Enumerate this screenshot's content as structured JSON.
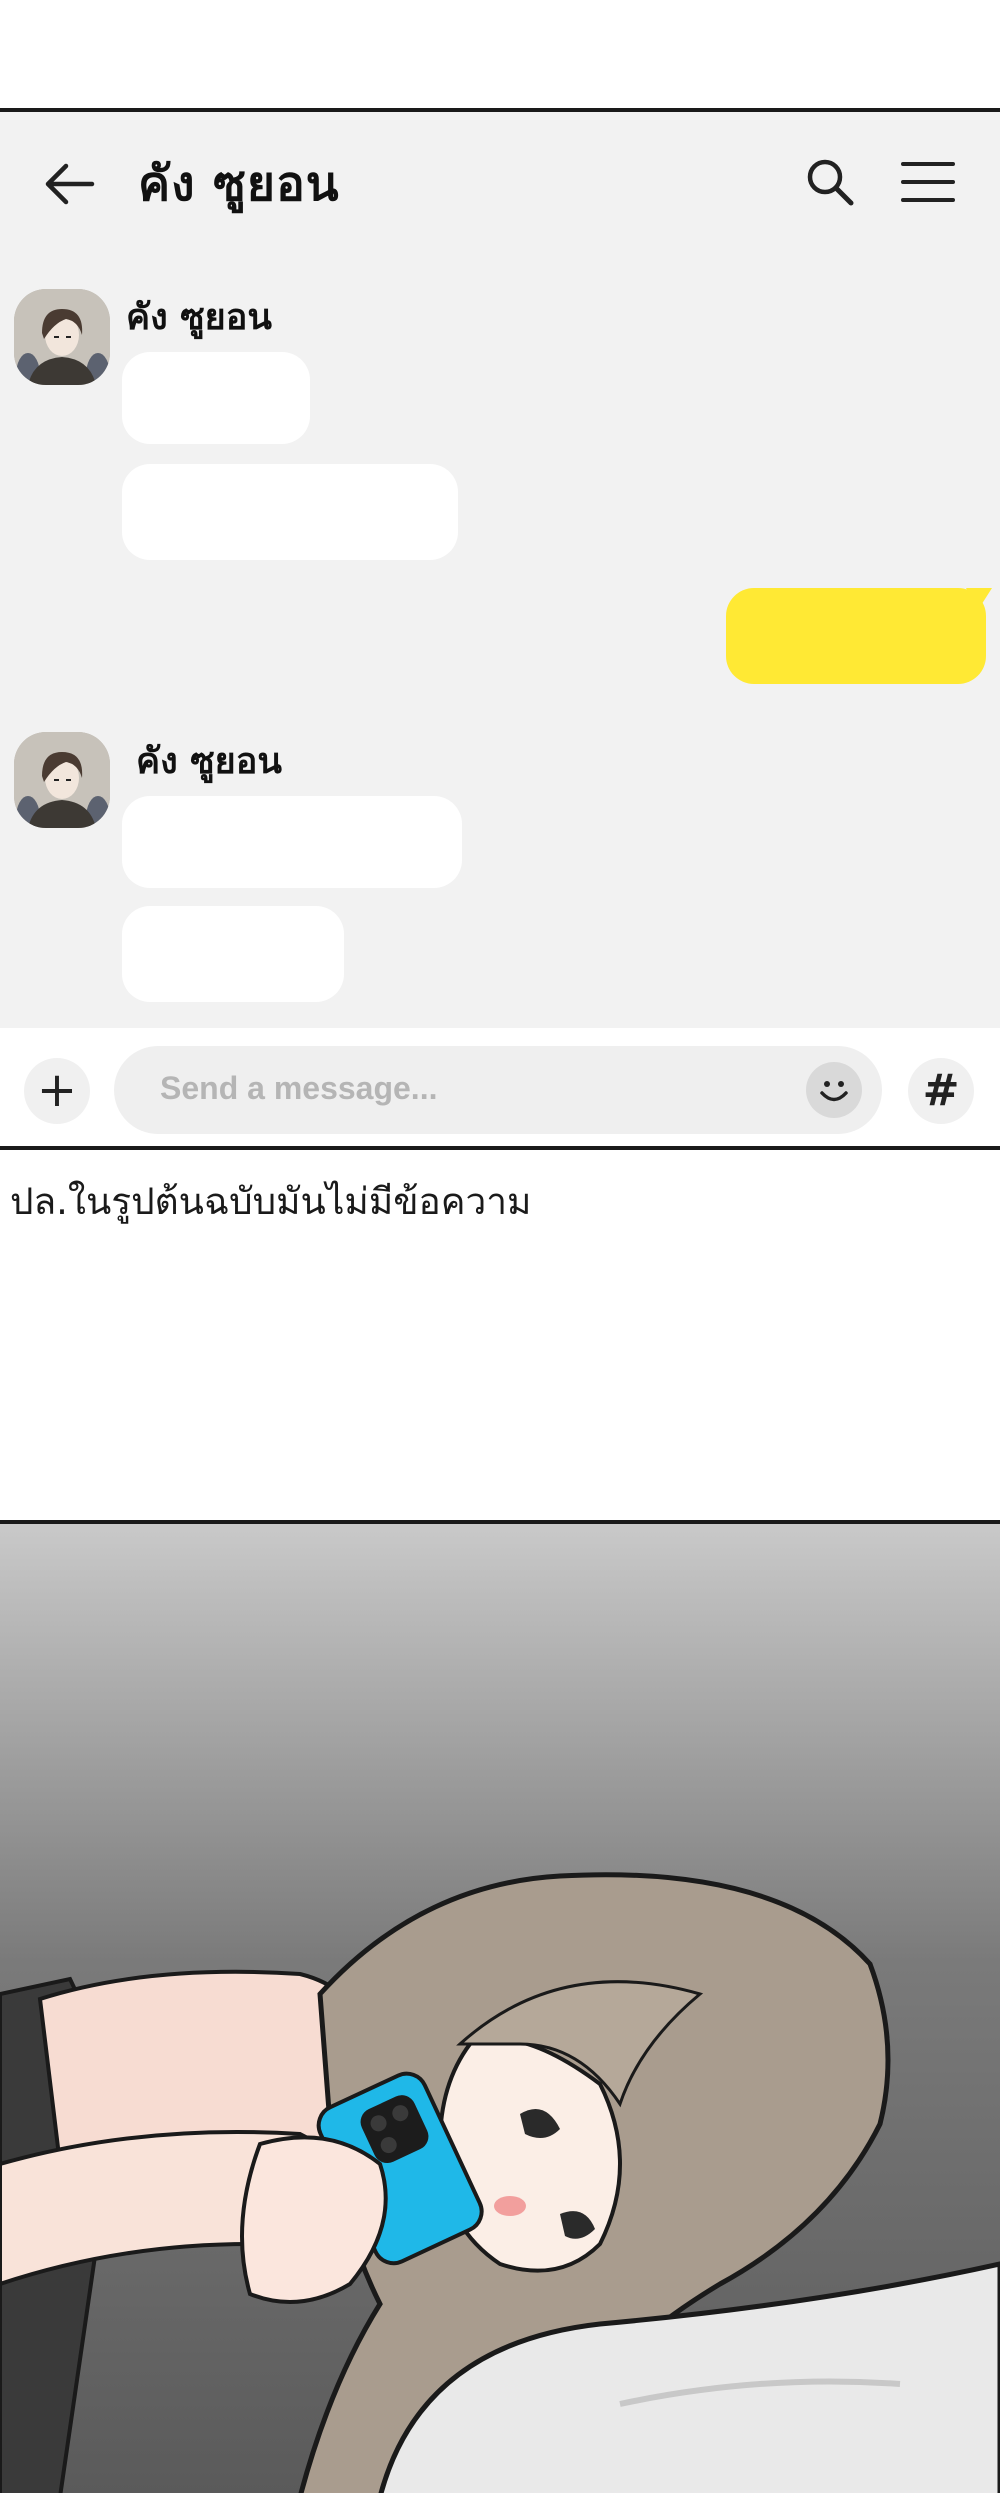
{
  "chat": {
    "contact_name": "คัง ซูยอน",
    "messages": [
      {
        "sender": "คัง ซูยอน",
        "side": "left"
      },
      {
        "sender": "คัง ซูยอน",
        "side": "left"
      }
    ],
    "input_placeholder": "Send a message...",
    "colors": {
      "background": "#f2f2f2",
      "incoming_bubble": "#ffffff",
      "outgoing_bubble": "#ffe934"
    }
  },
  "icons": [
    "back-arrow-icon",
    "search-icon",
    "menu-icon",
    "plus-icon",
    "emoji-icon",
    "hashtag-icon"
  ],
  "translator_note": "ปล.ในรูปต้นฉบับมันไม่มีข้อความ"
}
